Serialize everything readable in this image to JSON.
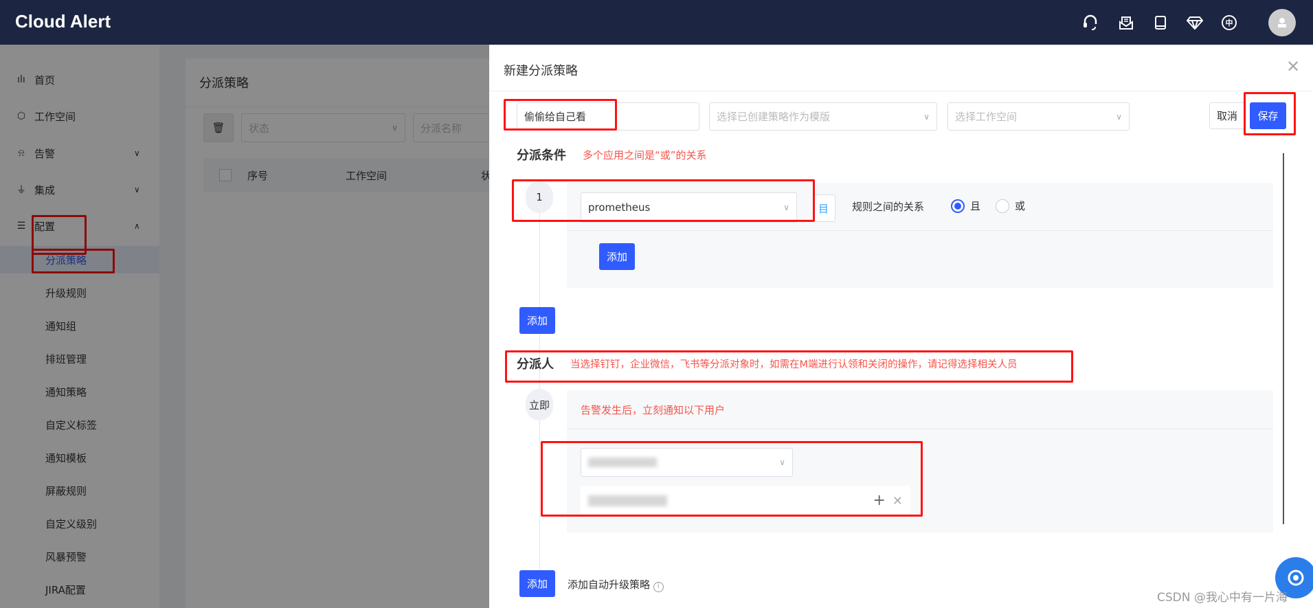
{
  "header": {
    "logo": "Cloud Alert",
    "icons": [
      "headset-icon",
      "inbox-icon",
      "book-icon",
      "diamond-icon",
      "language-icon"
    ],
    "language_label": "中"
  },
  "sidebar": {
    "items": [
      {
        "label": "首页",
        "icon": "chart-icon"
      },
      {
        "label": "工作空间",
        "icon": "cube-icon"
      },
      {
        "label": "告警",
        "icon": "alarm-icon",
        "chevron": "down"
      },
      {
        "label": "集成",
        "icon": "plug-icon",
        "chevron": "down"
      },
      {
        "label": "配置",
        "icon": "sliders-icon",
        "chevron": "up"
      }
    ],
    "subitems": [
      "分派策略",
      "升级规则",
      "通知组",
      "排班管理",
      "通知策略",
      "自定义标签",
      "通知模板",
      "屏蔽规则",
      "自定义级别",
      "风暴预警",
      "JIRA配置"
    ],
    "active": "分派策略"
  },
  "main": {
    "title": "分派策略",
    "filter_status_placeholder": "状态",
    "filter_name_placeholder": "分派名称",
    "columns": [
      "序号",
      "工作空间",
      "状"
    ]
  },
  "drawer": {
    "title": "新建分派策略",
    "name_value": "偷偷给自己看",
    "template_placeholder": "选择已创建策略作为模版",
    "workspace_placeholder": "选择工作空间",
    "cancel": "取消",
    "save": "保存",
    "conditions": {
      "heading": "分派条件",
      "note": "多个应用之间是“或”的关系",
      "index": "1",
      "app_value": "prometheus",
      "side_btn": "目",
      "relation_label": "规则之间的关系",
      "options": [
        "且",
        "或"
      ],
      "selected": "且",
      "add_inner": "添加",
      "add_outer": "添加"
    },
    "assignees": {
      "heading": "分派人",
      "note": "当选择钉钉，企业微信，飞书等分派对象时，如需在M端进行认领和关闭的操作，请记得选择相关人员",
      "stage": "立即",
      "stage_note": "告警发生后，立刻通知以下用户",
      "add": "添加",
      "escalation_label": "添加自动升级策略"
    }
  },
  "watermark": "CSDN @我心中有一片海",
  "colors": {
    "header": "#1c2541",
    "primary": "#2f5bff",
    "annotation": "#ff1111",
    "note": "#f5534b"
  }
}
